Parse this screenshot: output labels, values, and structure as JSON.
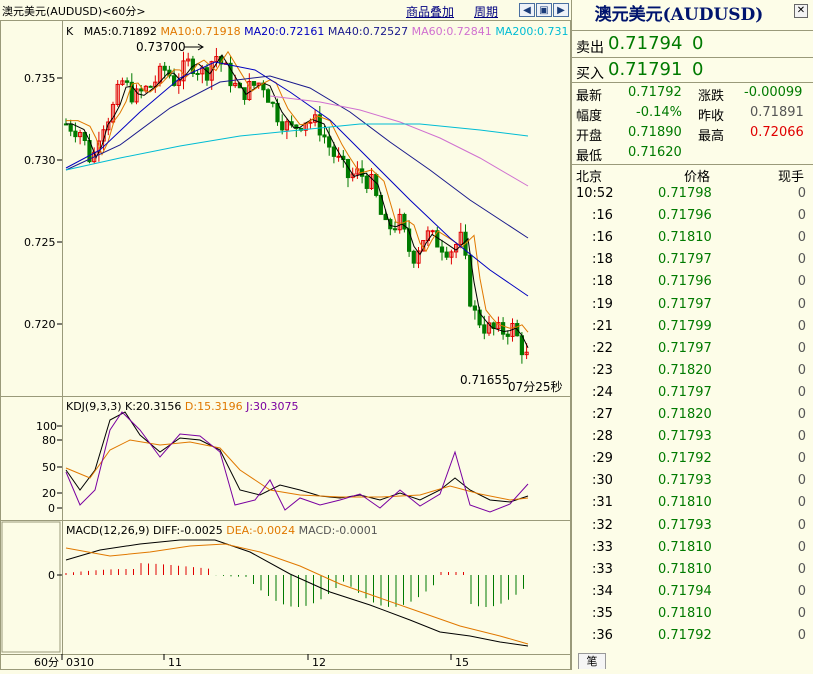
{
  "window": {
    "title": "澳元美元(AUDUSD)<60分>"
  },
  "toolbar": {
    "overlay_label": "商品叠加",
    "period_label": "周期",
    "nav_left": "◀",
    "nav_right": "▶",
    "nav_box": "▣"
  },
  "ma_legend": {
    "prefix": "K",
    "ma5": "MA5:0.71892",
    "ma10": "MA10:0.71918",
    "ma20": "MA20:0.72161",
    "ma40": "MA40:0.72527",
    "ma60": "MA60:0.72841",
    "ma200": "MA200:0.731"
  },
  "colors": {
    "ma5": "#000000",
    "ma10": "#e07800",
    "ma20": "#0000c0",
    "ma40": "#1a1a8c",
    "ma60": "#d070d0",
    "ma200": "#00bcd4",
    "up": "#e00000",
    "down": "#007a00",
    "bg": "#fcfce6"
  },
  "price_axis": {
    "labels": [
      "0.735",
      "0.730",
      "0.725",
      "0.720"
    ]
  },
  "annotations": {
    "high": "0.73700",
    "last_low": "0.71655",
    "countdown": "07分25秒"
  },
  "kdj": {
    "legend_name": "KDJ(9,3,3)",
    "k": "K:20.3156",
    "d": "D:15.3196",
    "j": "J:30.3075",
    "axis": [
      "100",
      "80",
      "50",
      "20",
      "0"
    ]
  },
  "macd": {
    "legend_name": "MACD(12,26,9)",
    "diff": "DIFF:-0.0025",
    "dea": "DEA:-0.0024",
    "macd": "MACD:-0.0001",
    "axis": [
      "0"
    ]
  },
  "x_axis": {
    "period": "60分",
    "labels": [
      "0310",
      "11",
      "12",
      "15"
    ]
  },
  "quote": {
    "title": "澳元美元(AUDUSD)",
    "sell_label": "卖出",
    "sell_price": "0.71794",
    "sell_vol": "0",
    "buy_label": "买入",
    "buy_price": "0.71791",
    "buy_vol": "0",
    "latest_label": "最新",
    "latest": "0.71792",
    "change_label": "涨跌",
    "change": "-0.00099",
    "amp_label": "幅度",
    "amp": "-0.14%",
    "prev_close_label": "昨收",
    "prev_close": "0.71891",
    "open_label": "开盘",
    "open": "0.71890",
    "high_label": "最高",
    "high": "0.72066",
    "low_label": "最低",
    "low": "0.71620"
  },
  "ticks": {
    "header_time": "北京",
    "header_price": "价格",
    "header_vol": "现手",
    "rows": [
      {
        "time": "10:52",
        "price": "0.71798",
        "vol": "0"
      },
      {
        "time": ":16",
        "price": "0.71796",
        "vol": "0"
      },
      {
        "time": ":16",
        "price": "0.71810",
        "vol": "0"
      },
      {
        "time": ":18",
        "price": "0.71797",
        "vol": "0"
      },
      {
        "time": ":18",
        "price": "0.71796",
        "vol": "0"
      },
      {
        "time": ":19",
        "price": "0.71797",
        "vol": "0"
      },
      {
        "time": ":21",
        "price": "0.71799",
        "vol": "0"
      },
      {
        "time": ":22",
        "price": "0.71797",
        "vol": "0"
      },
      {
        "time": ":23",
        "price": "0.71820",
        "vol": "0"
      },
      {
        "time": ":24",
        "price": "0.71797",
        "vol": "0"
      },
      {
        "time": ":27",
        "price": "0.71820",
        "vol": "0"
      },
      {
        "time": ":28",
        "price": "0.71793",
        "vol": "0"
      },
      {
        "time": ":29",
        "price": "0.71792",
        "vol": "0"
      },
      {
        "time": ":30",
        "price": "0.71793",
        "vol": "0"
      },
      {
        "time": ":31",
        "price": "0.71810",
        "vol": "0"
      },
      {
        "time": ":32",
        "price": "0.71793",
        "vol": "0"
      },
      {
        "time": ":33",
        "price": "0.71810",
        "vol": "0"
      },
      {
        "time": ":33",
        "price": "0.71810",
        "vol": "0"
      },
      {
        "time": ":34",
        "price": "0.71794",
        "vol": "0"
      },
      {
        "time": ":35",
        "price": "0.71810",
        "vol": "0"
      },
      {
        "time": ":36",
        "price": "0.71792",
        "vol": "0"
      }
    ]
  },
  "footer": {
    "tab": "笔"
  }
}
